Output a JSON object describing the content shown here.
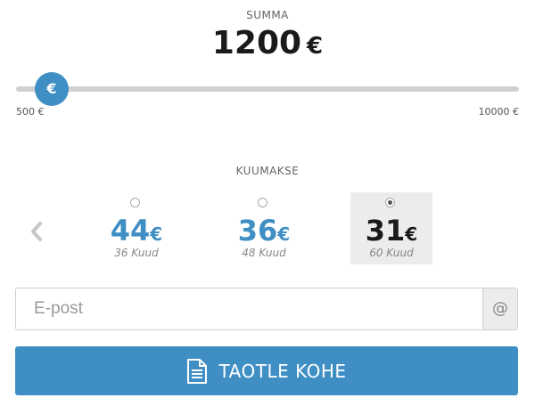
{
  "amount": {
    "label": "SUMMA",
    "value": "1200",
    "currency": "€",
    "slider": {
      "handle_symbol": "€",
      "min_label": "500 €",
      "max_label": "10000 €",
      "min": 500,
      "max": 10000,
      "current": 1200
    }
  },
  "payment": {
    "label": "KUUMAKSE",
    "prev_icon": "chevron-left-icon",
    "options": [
      {
        "amount": "44",
        "currency": "€",
        "term": "36 Kuud",
        "selected": false
      },
      {
        "amount": "36",
        "currency": "€",
        "term": "48 Kuud",
        "selected": false
      },
      {
        "amount": "31",
        "currency": "€",
        "term": "60 Kuud",
        "selected": true
      }
    ]
  },
  "email": {
    "placeholder": "E-post",
    "value": "",
    "addon": "@"
  },
  "submit": {
    "label": "TAOTLE KOHE",
    "icon": "document-icon"
  },
  "colors": {
    "accent": "#3f8fc5",
    "selected_bg": "#ececec",
    "track": "#d0d0d0"
  }
}
